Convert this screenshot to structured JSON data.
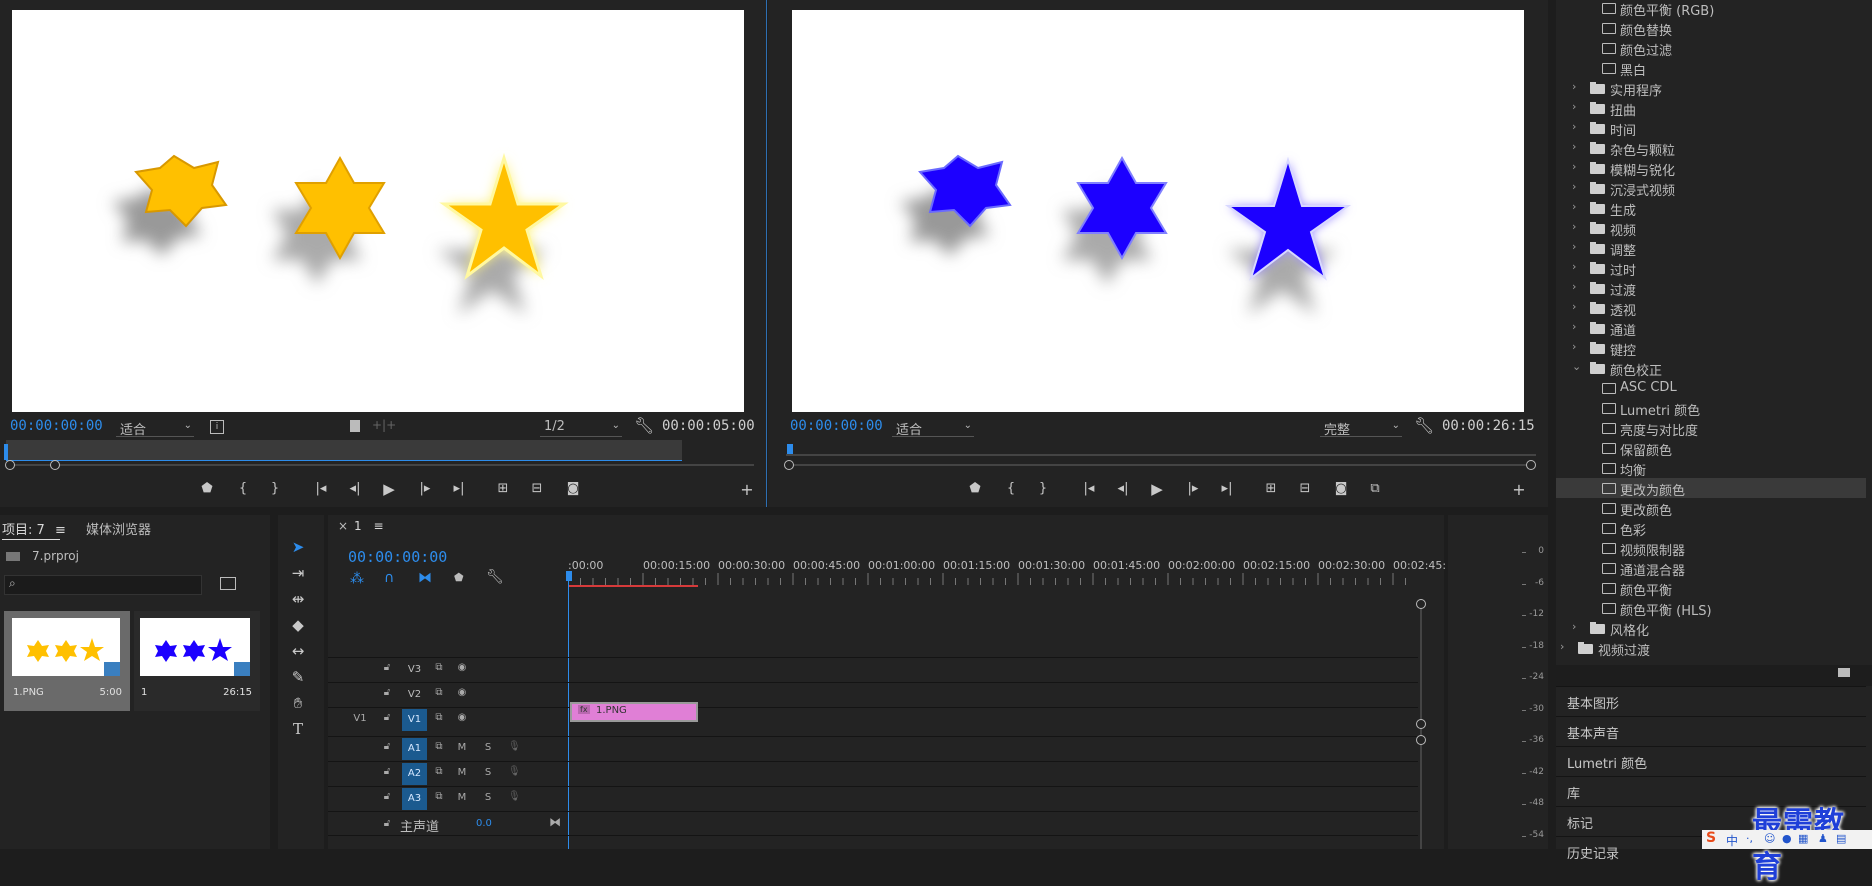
{
  "source_monitor": {
    "timecode": "00:00:00:00",
    "fit": "适合",
    "resolution": "1/2",
    "duration": "00:00:05:00"
  },
  "program_monitor": {
    "timecode": "00:00:00:00",
    "fit": "适合",
    "quality": "完整",
    "duration": "00:00:26:15"
  },
  "project": {
    "tab_project": "项目: 7",
    "tab_media": "媒体浏览器",
    "file": "7.prproj",
    "search_placeholder": "",
    "items": [
      {
        "name": "1.PNG",
        "duration": "5:00"
      },
      {
        "name": "1",
        "duration": "26:15"
      }
    ]
  },
  "timeline": {
    "close": "×",
    "sequence": "1",
    "timecode": "00:00:00:00",
    "ruler": [
      ":00:00",
      "00:00:15:00",
      "00:00:30:00",
      "00:00:45:00",
      "00:01:00:00",
      "00:01:15:00",
      "00:01:30:00",
      "00:01:45:00",
      "00:02:00:00",
      "00:02:15:00",
      "00:02:30:00",
      "00:02:45:"
    ],
    "video_tracks": [
      {
        "src": "",
        "name": "V3"
      },
      {
        "src": "",
        "name": "V2"
      },
      {
        "src": "V1",
        "name": "V1"
      }
    ],
    "audio_tracks": [
      {
        "name": "A1",
        "m": "M",
        "s": "S"
      },
      {
        "name": "A2",
        "m": "M",
        "s": "S"
      },
      {
        "name": "A3",
        "m": "M",
        "s": "S"
      }
    ],
    "master_label": "主声道",
    "master_value": "0.0",
    "clip_label": "1.PNG",
    "clip_fx": "fx"
  },
  "meter": {
    "labels": [
      "0",
      "-6",
      "-12",
      "-18",
      "-24",
      "-30",
      "-36",
      "-42",
      "-48",
      "-54"
    ]
  },
  "effects": {
    "items": [
      {
        "type": "item",
        "label": "颜色平衡 (RGB)"
      },
      {
        "type": "item",
        "label": "颜色替换"
      },
      {
        "type": "item",
        "label": "颜色过滤"
      },
      {
        "type": "item",
        "label": "黑白"
      },
      {
        "type": "folder",
        "label": "实用程序"
      },
      {
        "type": "folder",
        "label": "扭曲"
      },
      {
        "type": "folder",
        "label": "时间"
      },
      {
        "type": "folder",
        "label": "杂色与颗粒"
      },
      {
        "type": "folder",
        "label": "模糊与锐化"
      },
      {
        "type": "folder",
        "label": "沉浸式视频"
      },
      {
        "type": "folder",
        "label": "生成"
      },
      {
        "type": "folder",
        "label": "视频"
      },
      {
        "type": "folder",
        "label": "调整"
      },
      {
        "type": "folder",
        "label": "过时"
      },
      {
        "type": "folder",
        "label": "过渡"
      },
      {
        "type": "folder",
        "label": "透视"
      },
      {
        "type": "folder",
        "label": "通道"
      },
      {
        "type": "folder",
        "label": "键控"
      },
      {
        "type": "folder-open",
        "label": "颜色校正"
      },
      {
        "type": "item",
        "label": "ASC CDL"
      },
      {
        "type": "item",
        "label": "Lumetri 颜色"
      },
      {
        "type": "item",
        "label": "亮度与对比度"
      },
      {
        "type": "item",
        "label": "保留颜色"
      },
      {
        "type": "item",
        "label": "均衡"
      },
      {
        "type": "item-selected",
        "label": "更改为颜色"
      },
      {
        "type": "item",
        "label": "更改颜色"
      },
      {
        "type": "item",
        "label": "色彩"
      },
      {
        "type": "item",
        "label": "视频限制器"
      },
      {
        "type": "item",
        "label": "通道混合器"
      },
      {
        "type": "item",
        "label": "颜色平衡"
      },
      {
        "type": "item",
        "label": "颜色平衡 (HLS)"
      },
      {
        "type": "folder",
        "label": "风格化"
      },
      {
        "type": "folder-top",
        "label": "视频过渡"
      }
    ],
    "sections": [
      "基本图形",
      "基本声音",
      "Lumetri 颜色",
      "库",
      "标记",
      "历史记录"
    ]
  },
  "watermark": "最需教育",
  "ime": {
    "logo": "S",
    "lang": "中"
  },
  "colors": {
    "accent_blue": "#2d8ceb",
    "track_blue": "#1b5a8f",
    "clip_pink": "#e07fd6",
    "star_yellow": "#ffc000",
    "star_blue": "#1c00ff",
    "watermark_blue": "#1f3fd8"
  }
}
